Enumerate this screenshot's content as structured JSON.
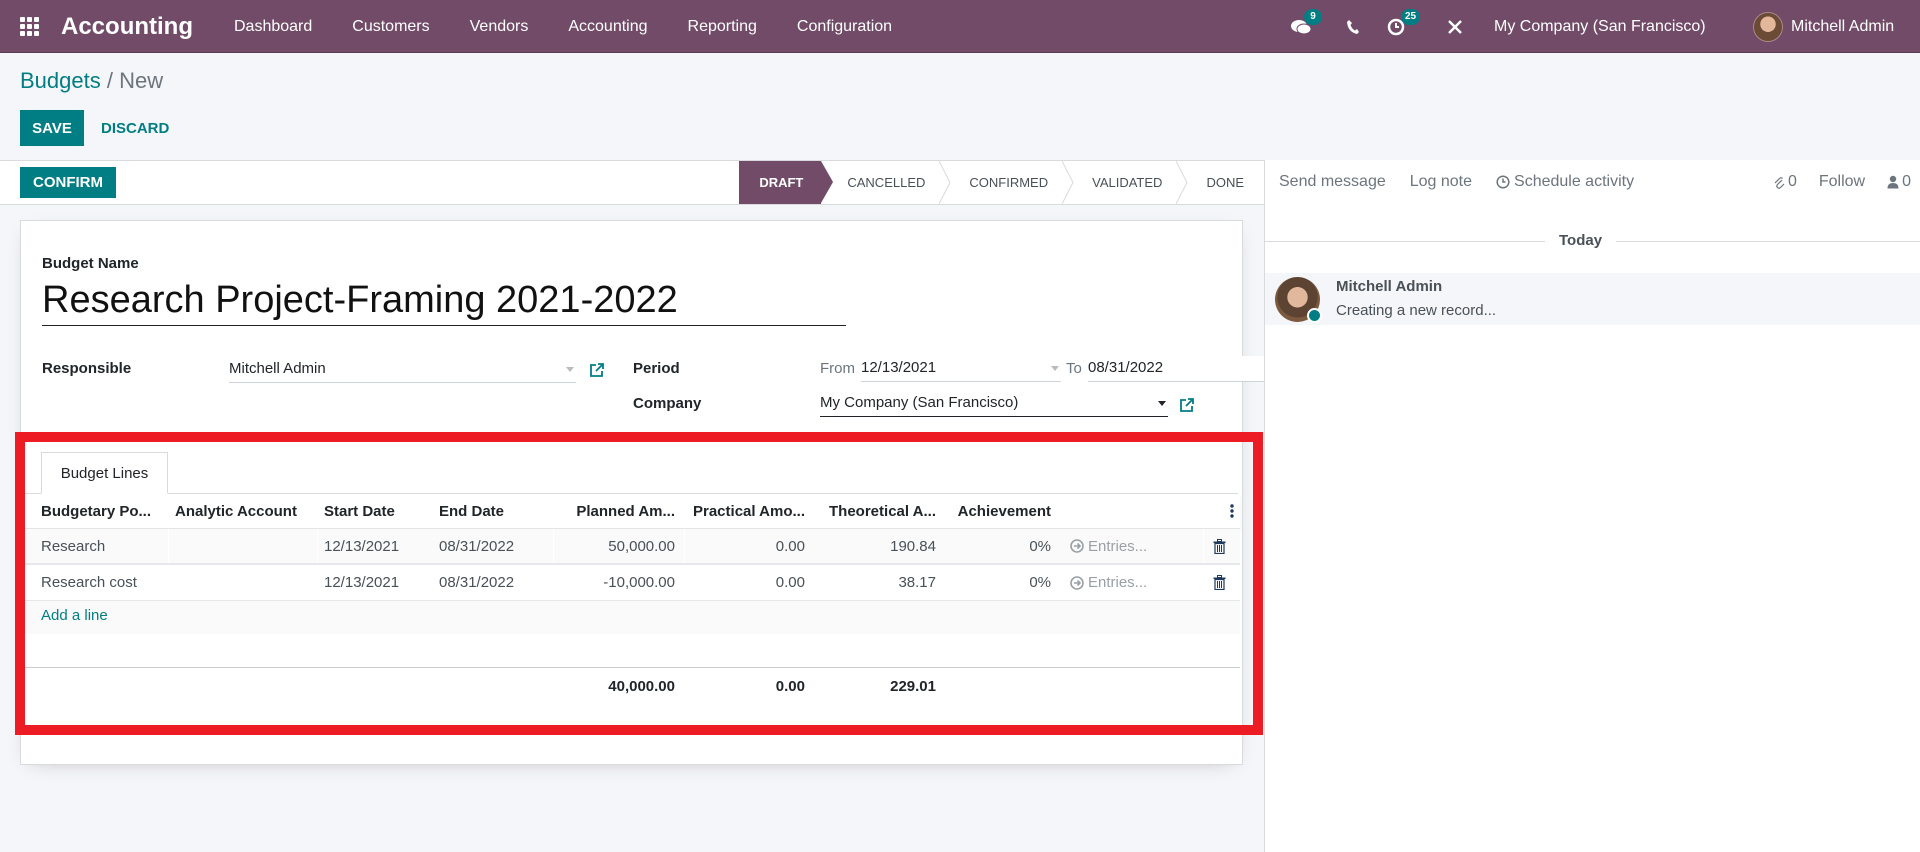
{
  "navbar": {
    "app_title": "Accounting",
    "menu": [
      "Dashboard",
      "Customers",
      "Vendors",
      "Accounting",
      "Reporting",
      "Configuration"
    ],
    "messages_count": "9",
    "activities_count": "25",
    "company": "My Company (San Francisco)",
    "user": "Mitchell Admin"
  },
  "breadcrumb": {
    "parent": "Budgets",
    "separator": "/",
    "current": "New"
  },
  "toolbar": {
    "save_label": "SAVE",
    "discard_label": "DISCARD"
  },
  "statusbar": {
    "confirm_label": "CONFIRM",
    "stages": [
      "DRAFT",
      "CANCELLED",
      "CONFIRMED",
      "VALIDATED",
      "DONE"
    ],
    "active_stage": "DRAFT"
  },
  "form": {
    "budget_name_label": "Budget Name",
    "budget_name": "Research Project-Framing 2021-2022",
    "responsible_label": "Responsible",
    "responsible": "Mitchell Admin",
    "period_label": "Period",
    "from_label": "From",
    "period_from": "12/13/2021",
    "to_label": "To",
    "period_to": "08/31/2022",
    "company_label": "Company",
    "company": "My Company (San Francisco)"
  },
  "budget_lines": {
    "tab_label": "Budget Lines",
    "columns": [
      "Budgetary Po...",
      "Analytic Account",
      "Start Date",
      "End Date",
      "Planned Am...",
      "Practical Amo...",
      "Theoretical A...",
      "Achievement"
    ],
    "rows": [
      {
        "budgetary_position": "Research",
        "analytic_account": "",
        "start_date": "12/13/2021",
        "end_date": "08/31/2022",
        "planned": "50,000.00",
        "practical": "0.00",
        "theoretical": "190.84",
        "achievement": "0%",
        "entries": "Entries..."
      },
      {
        "budgetary_position": "Research cost",
        "analytic_account": "",
        "start_date": "12/13/2021",
        "end_date": "08/31/2022",
        "planned": "-10,000.00",
        "practical": "0.00",
        "theoretical": "38.17",
        "achievement": "0%",
        "entries": "Entries..."
      }
    ],
    "add_line_label": "Add a line",
    "totals": {
      "planned": "40,000.00",
      "practical": "0.00",
      "theoretical": "229.01"
    }
  },
  "chatter": {
    "send_message": "Send message",
    "log_note": "Log note",
    "schedule_activity": "Schedule activity",
    "attachments_count": "0",
    "follow_label": "Follow",
    "followers_count": "0",
    "date_separator": "Today",
    "messages": [
      {
        "author": "Mitchell Admin",
        "body": "Creating a new record..."
      }
    ]
  },
  "colors": {
    "brand": "#714B67",
    "accent": "#017e84",
    "highlight_box": "#ed1c24"
  }
}
